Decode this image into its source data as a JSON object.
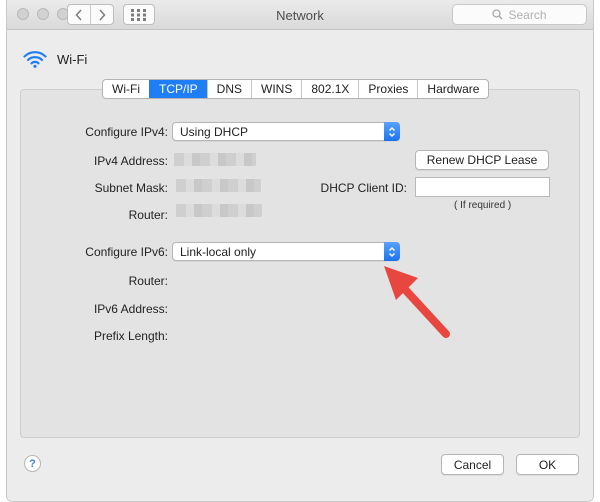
{
  "window": {
    "title": "Network"
  },
  "toolbar": {
    "back_icon": "chevron-left-icon",
    "forward_icon": "chevron-right-icon",
    "grid_icon": "grid-icon",
    "search_placeholder": "Search"
  },
  "service": {
    "name": "Wi-Fi",
    "icon": "wifi-icon",
    "icon_color": "#1f7ef5"
  },
  "tabs": [
    {
      "label": "Wi-Fi",
      "active": false
    },
    {
      "label": "TCP/IP",
      "active": true
    },
    {
      "label": "DNS",
      "active": false
    },
    {
      "label": "WINS",
      "active": false
    },
    {
      "label": "802.1X",
      "active": false
    },
    {
      "label": "Proxies",
      "active": false
    },
    {
      "label": "Hardware",
      "active": false
    }
  ],
  "ipv4": {
    "configure_label": "Configure IPv4:",
    "configure_value": "Using DHCP",
    "address_label": "IPv4 Address:",
    "subnet_label": "Subnet Mask:",
    "router_label": "Router:",
    "renew_button": "Renew DHCP Lease",
    "client_id_label": "DHCP Client ID:",
    "client_id_value": "",
    "client_id_hint": "( If required )"
  },
  "ipv6": {
    "configure_label": "Configure IPv6:",
    "configure_value": "Link-local only",
    "router_label": "Router:",
    "address_label": "IPv6 Address:",
    "prefix_label": "Prefix Length:"
  },
  "footer": {
    "help_label": "?",
    "cancel_button": "Cancel",
    "ok_button": "OK"
  },
  "colors": {
    "accent": "#1f7ef5",
    "annotation_arrow": "#e8473f"
  }
}
